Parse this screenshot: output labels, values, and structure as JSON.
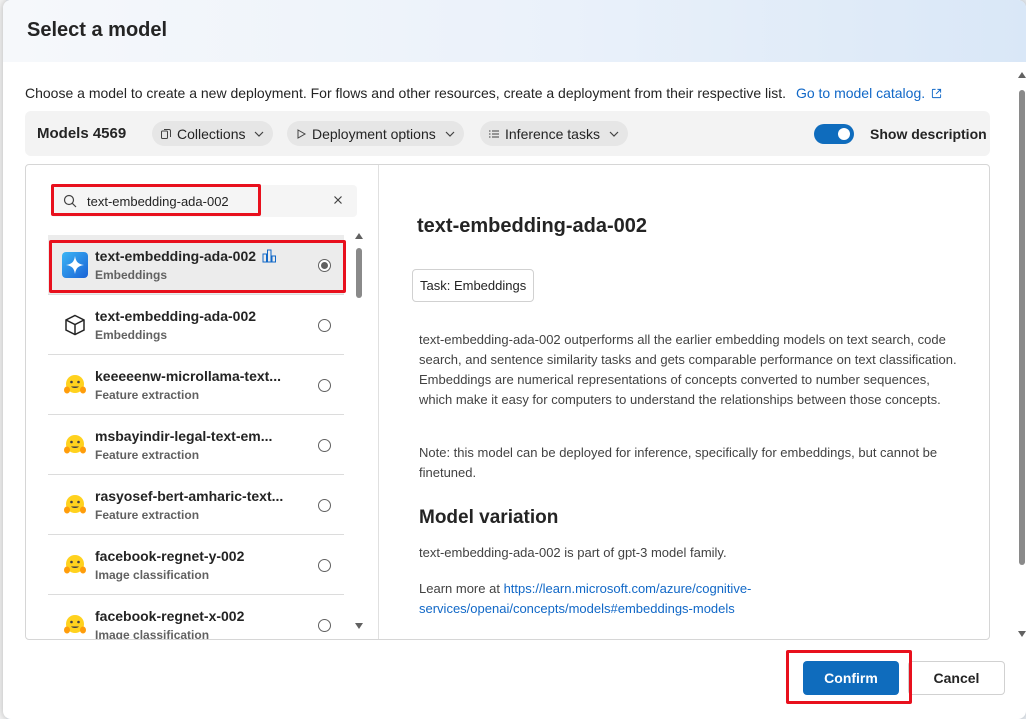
{
  "dialog": {
    "title": "Select a model",
    "intro": "Choose a model to create a new deployment. For flows and other resources, create a deployment from their respective list.",
    "catalog_link": "Go to model catalog."
  },
  "toolbar": {
    "models_label": "Models 4569",
    "collections": "Collections",
    "deployment_options": "Deployment options",
    "inference_tasks": "Inference tasks",
    "show_description": "Show description",
    "show_description_on": true
  },
  "search": {
    "value": "text-embedding-ada-002"
  },
  "models": [
    {
      "name": "text-embedding-ada-002",
      "task": "Embeddings",
      "icon": "azure-openai-icon",
      "selected": true
    },
    {
      "name": "text-embedding-ada-002",
      "task": "Embeddings",
      "icon": "cube-icon",
      "selected": false
    },
    {
      "name": "keeeeenw-microllama-text...",
      "task": "Feature extraction",
      "icon": "hugging-face-icon",
      "selected": false
    },
    {
      "name": "msbayindir-legal-text-em...",
      "task": "Feature extraction",
      "icon": "hugging-face-icon",
      "selected": false
    },
    {
      "name": "rasyosef-bert-amharic-text...",
      "task": "Feature extraction",
      "icon": "hugging-face-icon",
      "selected": false
    },
    {
      "name": "facebook-regnet-y-002",
      "task": "Image classification",
      "icon": "hugging-face-icon",
      "selected": false
    },
    {
      "name": "facebook-regnet-x-002",
      "task": "Image classification",
      "icon": "hugging-face-icon",
      "selected": false
    }
  ],
  "detail": {
    "title": "text-embedding-ada-002",
    "task_tag": "Task: Embeddings",
    "description": "text-embedding-ada-002 outperforms all the earlier embedding models on text search, code search, and sentence similarity tasks and gets comparable performance on text classification. Embeddings are numerical representations of concepts converted to number sequences, which make it easy for computers to understand the relationships between those concepts.",
    "note": "Note: this model can be deployed for inference, specifically for embeddings, but cannot be finetuned.",
    "variation_heading": "Model variation",
    "variation_text": "text-embedding-ada-002 is part of gpt-3 model family.",
    "learn_more_prefix": "Learn more at",
    "learn_more_link": "https://learn.microsoft.com/azure/cognitive-services/openai/concepts/models#embeddings-models"
  },
  "footer": {
    "confirm": "Confirm",
    "cancel": "Cancel"
  },
  "colors": {
    "accent": "#0f6cbd",
    "highlight": "#e8101d",
    "link": "#1168c7"
  }
}
